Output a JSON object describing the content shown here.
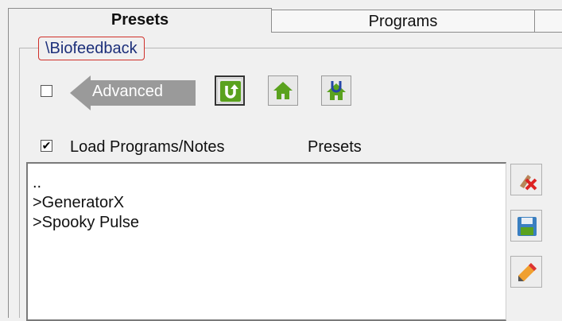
{
  "tabs": [
    {
      "label": "Presets",
      "active": true
    },
    {
      "label": "Programs",
      "active": false
    },
    {
      "label": "",
      "active": false
    }
  ],
  "group": {
    "title": "\\Biofeedback"
  },
  "advanced": {
    "checked": false,
    "label": "Advanced"
  },
  "toolbar": {
    "icons": [
      "refresh-icon",
      "home-icon",
      "home-u-icon"
    ],
    "colors": {
      "green": "#5aa21e",
      "blue": "#2345a8"
    }
  },
  "load_programs": {
    "checked": true,
    "label": "Load Programs/Notes",
    "check_glyph": "✔"
  },
  "presets_header": "Presets",
  "list": {
    "items": [
      "..",
      ">GeneratorX",
      ">Spooky Pulse"
    ]
  },
  "side_buttons": [
    "erase-icon",
    "save-icon",
    "edit-icon"
  ]
}
